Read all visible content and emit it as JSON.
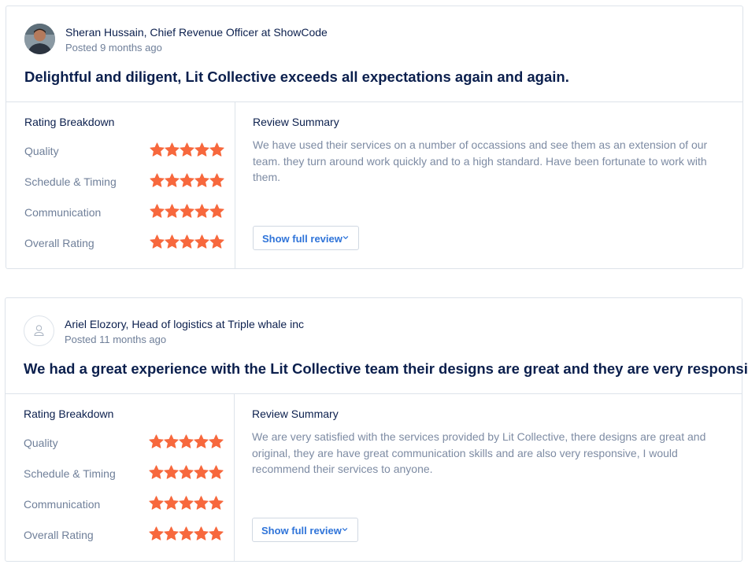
{
  "reviews": [
    {
      "author": "Sheran Hussain, Chief Revenue Officer at ShowCode",
      "posted": "Posted 9 months ago",
      "headline": "Delightful and diligent, Lit Collective exceeds all expectations again and again.",
      "breakdown_title": "Rating Breakdown",
      "ratings": [
        {
          "label": "Quality",
          "stars": 5
        },
        {
          "label": "Schedule & Timing",
          "stars": 5
        },
        {
          "label": "Communication",
          "stars": 5
        },
        {
          "label": "Overall Rating",
          "stars": 5
        }
      ],
      "summary_title": "Review Summary",
      "summary": "We have used their services on a number of occassions and see them as an extension of our team. they turn around work quickly and to a high standard. Have been fortunate to work with them.",
      "button_label": "Show full review"
    },
    {
      "author": "Ariel Elozory, Head of logistics at Triple whale inc",
      "posted": "Posted 11 months ago",
      "headline": "We had a great experience with the Lit Collective team their designs are great and they are very responsive",
      "breakdown_title": "Rating Breakdown",
      "ratings": [
        {
          "label": "Quality",
          "stars": 5
        },
        {
          "label": "Schedule & Timing",
          "stars": 5
        },
        {
          "label": "Communication",
          "stars": 5
        },
        {
          "label": "Overall Rating",
          "stars": 5
        }
      ],
      "summary_title": "Review Summary",
      "summary": "We are very satisfied with the services provided by Lit Collective, there designs are great and original, they are have great communication skills and are also very responsive, I would recommend their services to anyone.",
      "button_label": "Show full review"
    }
  ],
  "colors": {
    "star": "#f7683d",
    "link": "#2f74d9",
    "heading": "#0b1f4d",
    "muted": "#7d8ba3"
  },
  "icons": {
    "star": "star-icon",
    "chevron": "chevron-down-icon",
    "placeholder_avatar": "user-icon"
  }
}
